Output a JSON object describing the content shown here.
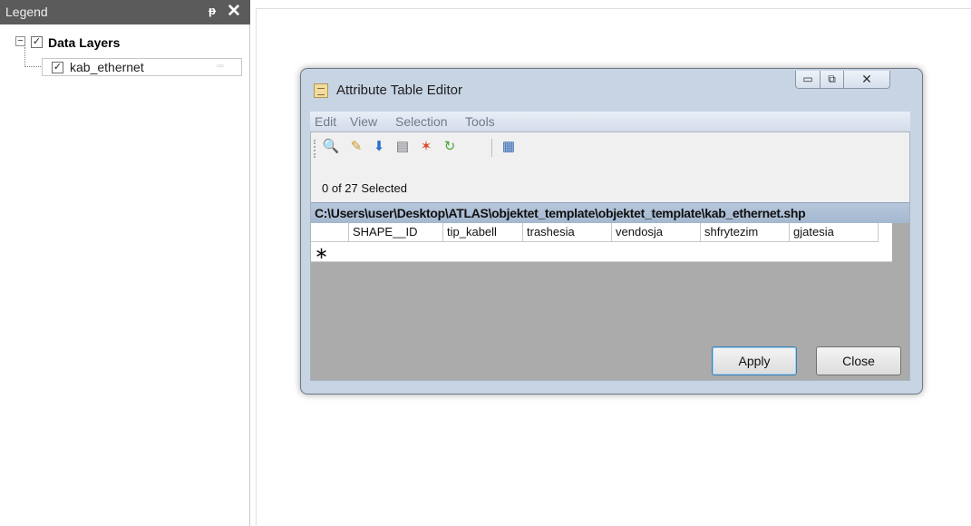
{
  "legend": {
    "title": "Legend",
    "pin_glyph": "ᵽ",
    "close_glyph": "✕",
    "root": {
      "label": "Data Layers",
      "checked": true,
      "expander": "−"
    },
    "layers": [
      {
        "label": "kab_ethernet",
        "checked": true
      }
    ]
  },
  "dialog": {
    "title": "Attribute Table Editor",
    "window_buttons": {
      "minimize": "▭",
      "maximize": "⧉",
      "close": "✕"
    },
    "menu": [
      "Edit",
      "View",
      "Selection",
      "Tools"
    ],
    "toolbar_icons": [
      "zoom-to-icon",
      "edit-icon",
      "download-arrow-icon",
      "calculator-icon",
      "paint-icon",
      "refresh-icon",
      "table-icon"
    ],
    "selection_status": "0 of 27 Selected",
    "file_path": "C:\\Users\\user\\Desktop\\ATLAS\\objektet_template\\objektet_template\\kab_ethernet.shp",
    "columns": [
      "SHAPE__ID",
      "tip_kabell",
      "trashesia",
      "vendosja",
      "shfrytezim",
      "gjatesia"
    ],
    "new_row_marker": "∗",
    "apply_label": "Apply",
    "close_label": "Close"
  }
}
